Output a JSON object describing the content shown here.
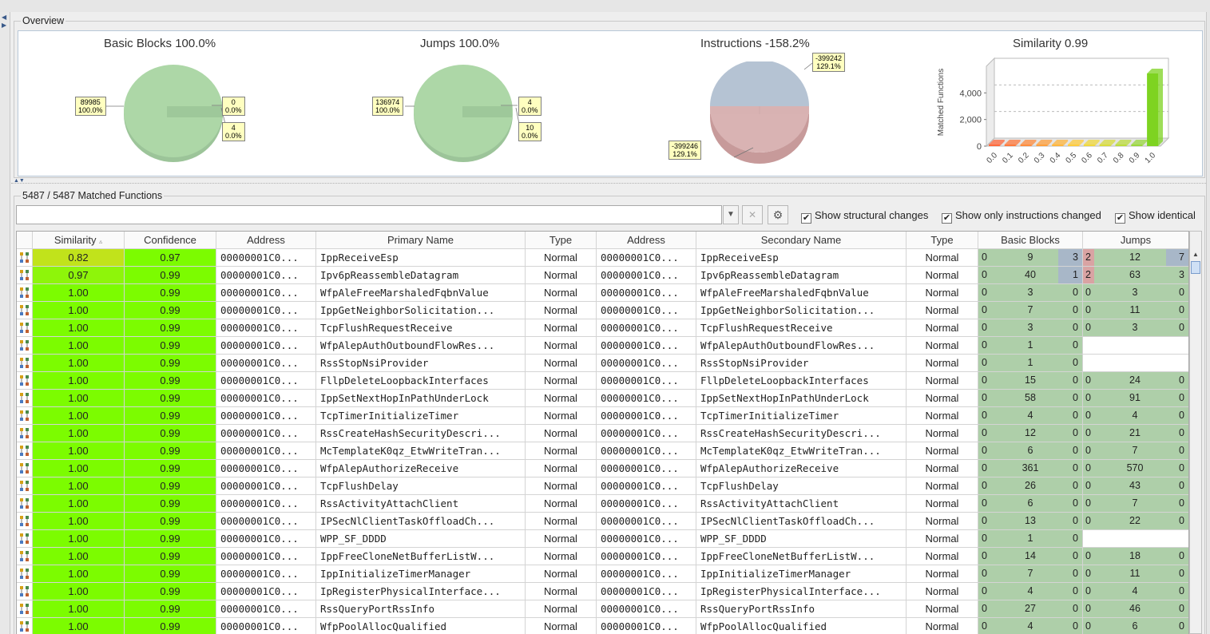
{
  "overview": {
    "title": "Overview",
    "basic_blocks": {
      "title": "Basic Blocks 100.0%",
      "callout_left": [
        "89985",
        "100.0%"
      ],
      "callout_right_top": [
        "0",
        "0.0%"
      ],
      "callout_right_bottom": [
        "4",
        "0.0%"
      ]
    },
    "jumps": {
      "title": "Jumps 100.0%",
      "callout_left": [
        "136974",
        "100.0%"
      ],
      "callout_right_top": [
        "4",
        "0.0%"
      ],
      "callout_right_bottom": [
        "10",
        "0.0%"
      ]
    },
    "instructions": {
      "title": "Instructions -158.2%",
      "callout_top": [
        "-399242",
        "129.1%"
      ],
      "callout_bottom": [
        "-399246",
        "129.1%"
      ]
    },
    "similarity": {
      "title": "Similarity 0.99",
      "ylabel": "Matched Functions",
      "yticks": [
        "4,000",
        "2,000",
        "0"
      ],
      "xticks": [
        "0.0",
        "0.1",
        "0.2",
        "0.3",
        "0.4",
        "0.5",
        "0.6",
        "0.7",
        "0.8",
        "0.9",
        "1.0"
      ]
    }
  },
  "chart_data": {
    "type": "bar",
    "title": "Similarity 0.99",
    "ylabel": "Matched Functions",
    "xlabel": "",
    "categories": [
      "0.0",
      "0.1",
      "0.2",
      "0.3",
      "0.4",
      "0.5",
      "0.6",
      "0.7",
      "0.8",
      "0.9",
      "1.0"
    ],
    "values": [
      0,
      0,
      0,
      0,
      0,
      0,
      0,
      0,
      0,
      20,
      5460
    ],
    "ylim": [
      0,
      6000
    ],
    "colors": [
      "#ff6a3d",
      "#ff7a3d",
      "#ff8c3d",
      "#ffa03d",
      "#ffb63d",
      "#ffcc3d",
      "#f0d83d",
      "#d8dc3d",
      "#bcdc3d",
      "#9ad83d",
      "#7ed321"
    ]
  },
  "matched": {
    "title": "5487 / 5487 Matched Functions",
    "filter_value": "",
    "buttons": {
      "dropdown": "▼",
      "clear": "✕",
      "settings": "⚙"
    },
    "checks": [
      {
        "label": "Show structural changes",
        "mark": "✔"
      },
      {
        "label": "Show only instructions changed",
        "mark": "✔"
      },
      {
        "label": "Show identical",
        "mark": "✔"
      }
    ]
  },
  "table": {
    "headers": [
      "Similarity",
      "Confidence",
      "Address",
      "Primary Name",
      "Type",
      "Address",
      "Secondary Name",
      "Type",
      "Basic Blocks",
      "Jumps"
    ],
    "sort_indicator": "▵",
    "rows": [
      {
        "sim": "0.82",
        "conf": "0.97",
        "addr1": "00000001C0...",
        "name1": "IppReceiveEsp",
        "type1": "Normal",
        "addr2": "00000001C0...",
        "name2": "IppReceiveEsp",
        "type2": "Normal",
        "bb": [
          "0",
          "9",
          "3"
        ],
        "j": [
          "2",
          "12",
          "7"
        ]
      },
      {
        "sim": "0.97",
        "conf": "0.99",
        "addr1": "00000001C0...",
        "name1": "Ipv6pReassembleDatagram",
        "type1": "Normal",
        "addr2": "00000001C0...",
        "name2": "Ipv6pReassembleDatagram",
        "type2": "Normal",
        "bb": [
          "0",
          "40",
          "1"
        ],
        "j": [
          "2",
          "63",
          "3"
        ]
      },
      {
        "sim": "1.00",
        "conf": "0.99",
        "addr1": "00000001C0...",
        "name1": "WfpAleFreeMarshaledFqbnValue",
        "type1": "Normal",
        "addr2": "00000001C0...",
        "name2": "WfpAleFreeMarshaledFqbnValue",
        "type2": "Normal",
        "bb": [
          "0",
          "3",
          "0"
        ],
        "j": [
          "0",
          "3",
          "0"
        ]
      },
      {
        "sim": "1.00",
        "conf": "0.99",
        "addr1": "00000001C0...",
        "name1": "IppGetNeighborSolicitation...",
        "type1": "Normal",
        "addr2": "00000001C0...",
        "name2": "IppGetNeighborSolicitation...",
        "type2": "Normal",
        "bb": [
          "0",
          "7",
          "0"
        ],
        "j": [
          "0",
          "11",
          "0"
        ]
      },
      {
        "sim": "1.00",
        "conf": "0.99",
        "addr1": "00000001C0...",
        "name1": "TcpFlushRequestReceive",
        "type1": "Normal",
        "addr2": "00000001C0...",
        "name2": "TcpFlushRequestReceive",
        "type2": "Normal",
        "bb": [
          "0",
          "3",
          "0"
        ],
        "j": [
          "0",
          "3",
          "0"
        ]
      },
      {
        "sim": "1.00",
        "conf": "0.99",
        "addr1": "00000001C0...",
        "name1": "WfpAlepAuthOutboundFlowRes...",
        "type1": "Normal",
        "addr2": "00000001C0...",
        "name2": "WfpAlepAuthOutboundFlowRes...",
        "type2": "Normal",
        "bb": [
          "0",
          "1",
          "0"
        ],
        "j": null
      },
      {
        "sim": "1.00",
        "conf": "0.99",
        "addr1": "00000001C0...",
        "name1": "RssStopNsiProvider",
        "type1": "Normal",
        "addr2": "00000001C0...",
        "name2": "RssStopNsiProvider",
        "type2": "Normal",
        "bb": [
          "0",
          "1",
          "0"
        ],
        "j": null
      },
      {
        "sim": "1.00",
        "conf": "0.99",
        "addr1": "00000001C0...",
        "name1": "FllpDeleteLoopbackInterfaces",
        "type1": "Normal",
        "addr2": "00000001C0...",
        "name2": "FllpDeleteLoopbackInterfaces",
        "type2": "Normal",
        "bb": [
          "0",
          "15",
          "0"
        ],
        "j": [
          "0",
          "24",
          "0"
        ]
      },
      {
        "sim": "1.00",
        "conf": "0.99",
        "addr1": "00000001C0...",
        "name1": "IppSetNextHopInPathUnderLock",
        "type1": "Normal",
        "addr2": "00000001C0...",
        "name2": "IppSetNextHopInPathUnderLock",
        "type2": "Normal",
        "bb": [
          "0",
          "58",
          "0"
        ],
        "j": [
          "0",
          "91",
          "0"
        ]
      },
      {
        "sim": "1.00",
        "conf": "0.99",
        "addr1": "00000001C0...",
        "name1": "TcpTimerInitializeTimer",
        "type1": "Normal",
        "addr2": "00000001C0...",
        "name2": "TcpTimerInitializeTimer",
        "type2": "Normal",
        "bb": [
          "0",
          "4",
          "0"
        ],
        "j": [
          "0",
          "4",
          "0"
        ]
      },
      {
        "sim": "1.00",
        "conf": "0.99",
        "addr1": "00000001C0...",
        "name1": "RssCreateHashSecurityDescri...",
        "type1": "Normal",
        "addr2": "00000001C0...",
        "name2": "RssCreateHashSecurityDescri...",
        "type2": "Normal",
        "bb": [
          "0",
          "12",
          "0"
        ],
        "j": [
          "0",
          "21",
          "0"
        ]
      },
      {
        "sim": "1.00",
        "conf": "0.99",
        "addr1": "00000001C0...",
        "name1": "McTemplateK0qz_EtwWriteTran...",
        "type1": "Normal",
        "addr2": "00000001C0...",
        "name2": "McTemplateK0qz_EtwWriteTran...",
        "type2": "Normal",
        "bb": [
          "0",
          "6",
          "0"
        ],
        "j": [
          "0",
          "7",
          "0"
        ]
      },
      {
        "sim": "1.00",
        "conf": "0.99",
        "addr1": "00000001C0...",
        "name1": "WfpAlepAuthorizeReceive",
        "type1": "Normal",
        "addr2": "00000001C0...",
        "name2": "WfpAlepAuthorizeReceive",
        "type2": "Normal",
        "bb": [
          "0",
          "361",
          "0"
        ],
        "j": [
          "0",
          "570",
          "0"
        ]
      },
      {
        "sim": "1.00",
        "conf": "0.99",
        "addr1": "00000001C0...",
        "name1": "TcpFlushDelay",
        "type1": "Normal",
        "addr2": "00000001C0...",
        "name2": "TcpFlushDelay",
        "type2": "Normal",
        "bb": [
          "0",
          "26",
          "0"
        ],
        "j": [
          "0",
          "43",
          "0"
        ]
      },
      {
        "sim": "1.00",
        "conf": "0.99",
        "addr1": "00000001C0...",
        "name1": "RssActivityAttachClient",
        "type1": "Normal",
        "addr2": "00000001C0...",
        "name2": "RssActivityAttachClient",
        "type2": "Normal",
        "bb": [
          "0",
          "6",
          "0"
        ],
        "j": [
          "0",
          "7",
          "0"
        ]
      },
      {
        "sim": "1.00",
        "conf": "0.99",
        "addr1": "00000001C0...",
        "name1": "IPSecNlClientTaskOffloadCh...",
        "type1": "Normal",
        "addr2": "00000001C0...",
        "name2": "IPSecNlClientTaskOffloadCh...",
        "type2": "Normal",
        "bb": [
          "0",
          "13",
          "0"
        ],
        "j": [
          "0",
          "22",
          "0"
        ]
      },
      {
        "sim": "1.00",
        "conf": "0.99",
        "addr1": "00000001C0...",
        "name1": "WPP_SF_DDDD",
        "type1": "Normal",
        "addr2": "00000001C0...",
        "name2": "WPP_SF_DDDD",
        "type2": "Normal",
        "bb": [
          "0",
          "1",
          "0"
        ],
        "j": null
      },
      {
        "sim": "1.00",
        "conf": "0.99",
        "addr1": "00000001C0...",
        "name1": "IppFreeCloneNetBufferListW...",
        "type1": "Normal",
        "addr2": "00000001C0...",
        "name2": "IppFreeCloneNetBufferListW...",
        "type2": "Normal",
        "bb": [
          "0",
          "14",
          "0"
        ],
        "j": [
          "0",
          "18",
          "0"
        ]
      },
      {
        "sim": "1.00",
        "conf": "0.99",
        "addr1": "00000001C0...",
        "name1": "IppInitializeTimerManager",
        "type1": "Normal",
        "addr2": "00000001C0...",
        "name2": "IppInitializeTimerManager",
        "type2": "Normal",
        "bb": [
          "0",
          "7",
          "0"
        ],
        "j": [
          "0",
          "11",
          "0"
        ]
      },
      {
        "sim": "1.00",
        "conf": "0.99",
        "addr1": "00000001C0...",
        "name1": "IpRegisterPhysicalInterface...",
        "type1": "Normal",
        "addr2": "00000001C0...",
        "name2": "IpRegisterPhysicalInterface...",
        "type2": "Normal",
        "bb": [
          "0",
          "4",
          "0"
        ],
        "j": [
          "0",
          "4",
          "0"
        ]
      },
      {
        "sim": "1.00",
        "conf": "0.99",
        "addr1": "00000001C0...",
        "name1": "RssQueryPortRssInfo",
        "type1": "Normal",
        "addr2": "00000001C0...",
        "name2": "RssQueryPortRssInfo",
        "type2": "Normal",
        "bb": [
          "0",
          "27",
          "0"
        ],
        "j": [
          "0",
          "46",
          "0"
        ]
      },
      {
        "sim": "1.00",
        "conf": "0.99",
        "addr1": "00000001C0...",
        "name1": "WfpPoolAllocQualified",
        "type1": "Normal",
        "addr2": "00000001C0...",
        "name2": "WfpPoolAllocQualified",
        "type2": "Normal",
        "bb": [
          "0",
          "4",
          "0"
        ],
        "j": [
          "0",
          "6",
          "0"
        ]
      }
    ]
  }
}
